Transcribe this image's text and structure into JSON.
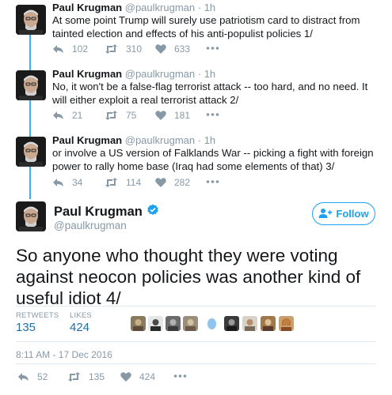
{
  "thread": [
    {
      "name": "Paul Krugman",
      "handle": "@paulkrugman",
      "sep": "·",
      "time": "1h",
      "text": "At some point Trump will surely use patriotism card to distract from tainted election and effects of his anti-populist policies 1/",
      "replies": "102",
      "retweets": "310",
      "likes": "633"
    },
    {
      "name": "Paul Krugman",
      "handle": "@paulkrugman",
      "sep": "·",
      "time": "1h",
      "text": "No, it won't be a false-flag terrorist attack -- too hard, and no need. It will either exploit a real terrorist attack 2/",
      "replies": "21",
      "retweets": "75",
      "likes": "181"
    },
    {
      "name": "Paul Krugman",
      "handle": "@paulkrugman",
      "sep": "·",
      "time": "1h",
      "text": "or involve a US version of Falklands War -- picking a fight with foreign power to rally home base (Iraq had some elements of that) 3/",
      "replies": "34",
      "retweets": "114",
      "likes": "282"
    }
  ],
  "main": {
    "name": "Paul Krugman",
    "handle": "@paulkrugman",
    "follow_label": "Follow",
    "text": "So anyone who thought they were voting against neocon policies was another kind of useful idiot 4/",
    "retweets_label": "RETWEETS",
    "retweets_value": "135",
    "likes_label": "LIKES",
    "likes_value": "424",
    "timestamp": "8:11 AM - 17 Dec 2016",
    "replies": "52",
    "retweets": "135",
    "likes": "424"
  },
  "colors": {
    "accent": "#1da1f2",
    "muted": "#8899a6",
    "stat_value": "#1d6fa8"
  },
  "icons": [
    "reply-icon",
    "retweet-icon",
    "like-icon",
    "more-icon",
    "verified-icon",
    "follow-person-icon"
  ]
}
